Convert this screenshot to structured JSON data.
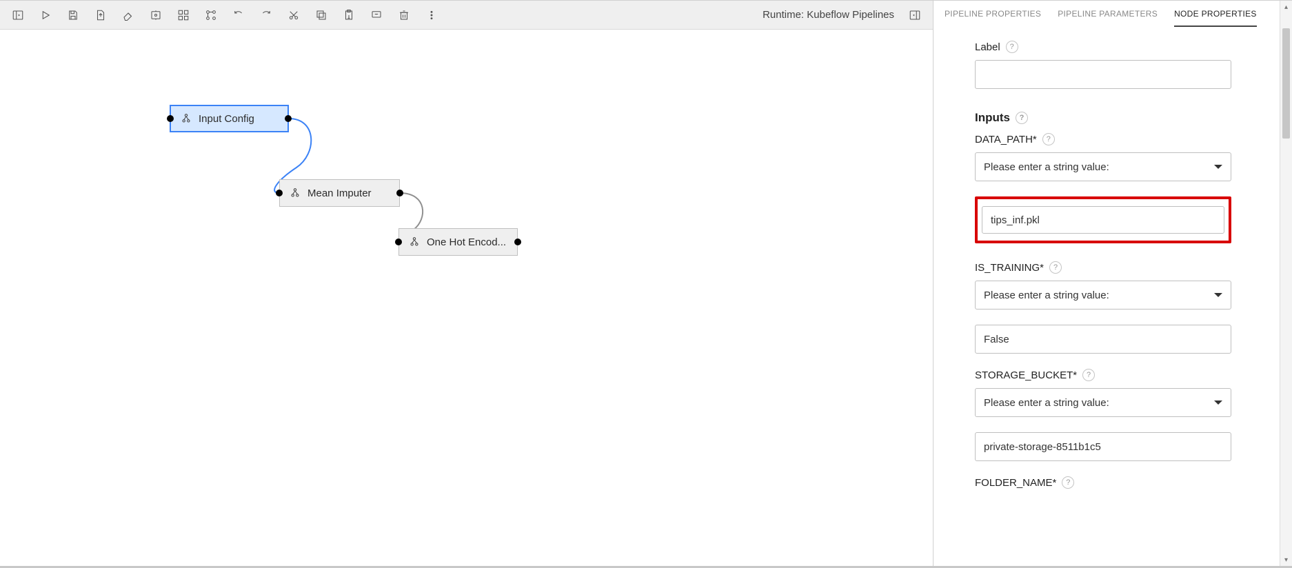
{
  "toolbar": {
    "runtime_label": "Runtime: Kubeflow Pipelines"
  },
  "canvas": {
    "nodes": {
      "input_config": {
        "label": "Input Config"
      },
      "mean_imputer": {
        "label": "Mean Imputer"
      },
      "one_hot": {
        "label": "One Hot Encod..."
      }
    }
  },
  "panel": {
    "tabs": {
      "pipeline_properties": "PIPELINE PROPERTIES",
      "pipeline_parameters": "PIPELINE PARAMETERS",
      "node_properties": "NODE PROPERTIES"
    },
    "label_field": {
      "title": "Label",
      "value": ""
    },
    "inputs_title": "Inputs",
    "select_placeholder": "Please enter a string value:",
    "fields": {
      "data_path": {
        "label": "DATA_PATH*",
        "value": "tips_inf.pkl"
      },
      "is_training": {
        "label": "IS_TRAINING*",
        "value": "False"
      },
      "storage_bucket": {
        "label": "STORAGE_BUCKET*",
        "value": "private-storage-8511b1c5"
      },
      "folder_name": {
        "label": "FOLDER_NAME*"
      }
    }
  }
}
